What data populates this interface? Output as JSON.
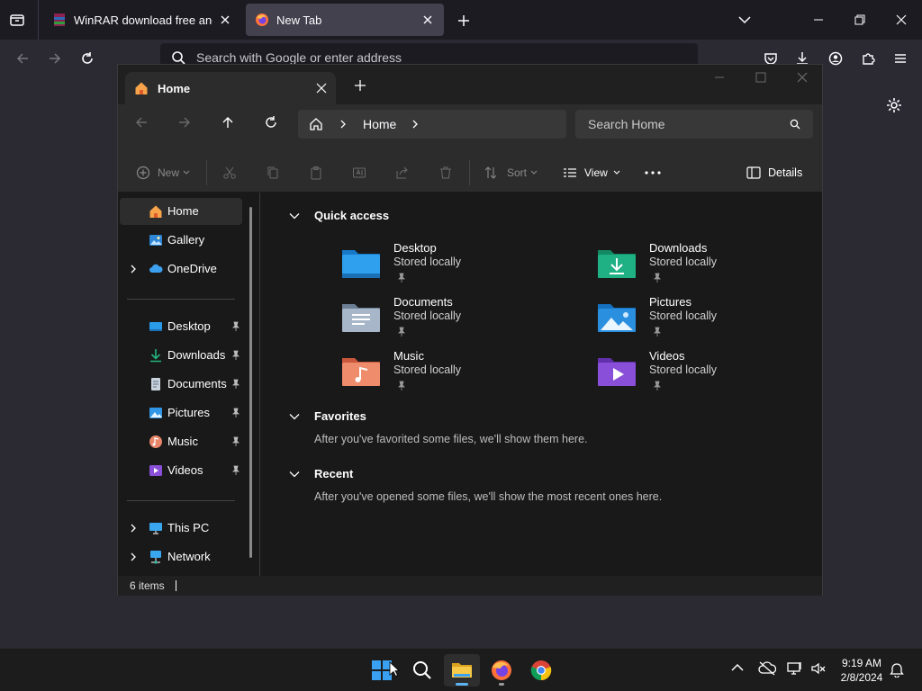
{
  "browser": {
    "tabs": [
      {
        "title": "WinRAR download free and support"
      },
      {
        "title": "New Tab"
      }
    ],
    "urlbar_placeholder": "Search with Google or enter address"
  },
  "explorer": {
    "tab_title": "Home",
    "breadcrumb": [
      "Home"
    ],
    "search_placeholder": "Search Home",
    "toolbar": {
      "new_label": "New",
      "sort_label": "Sort",
      "view_label": "View",
      "details_label": "Details"
    },
    "sidebar": {
      "top": [
        {
          "label": "Home",
          "icon": "home-icon",
          "selected": true
        },
        {
          "label": "Gallery",
          "icon": "gallery-icon"
        },
        {
          "label": "OneDrive",
          "icon": "onedrive-icon",
          "expandable": true
        }
      ],
      "pinned": [
        {
          "label": "Desktop",
          "icon": "desktop-folder-icon"
        },
        {
          "label": "Downloads",
          "icon": "downloads-icon"
        },
        {
          "label": "Documents",
          "icon": "documents-icon"
        },
        {
          "label": "Pictures",
          "icon": "pictures-icon"
        },
        {
          "label": "Music",
          "icon": "music-icon"
        },
        {
          "label": "Videos",
          "icon": "videos-icon"
        }
      ],
      "bottom": [
        {
          "label": "This PC",
          "icon": "this-pc-icon",
          "expandable": true
        },
        {
          "label": "Network",
          "icon": "network-icon",
          "expandable": true
        }
      ]
    },
    "sections": {
      "quick_access": {
        "title": "Quick access",
        "items": [
          {
            "name": "Desktop",
            "sub": "Stored locally",
            "color": "#1e90e6"
          },
          {
            "name": "Downloads",
            "sub": "Stored locally",
            "color": "#1aa37a"
          },
          {
            "name": "Documents",
            "sub": "Stored locally",
            "color": "#8ea3bd"
          },
          {
            "name": "Pictures",
            "sub": "Stored locally",
            "color": "#2b8fe0"
          },
          {
            "name": "Music",
            "sub": "Stored locally",
            "color": "#e8866a"
          },
          {
            "name": "Videos",
            "sub": "Stored locally",
            "color": "#8a4fd8"
          }
        ]
      },
      "favorites": {
        "title": "Favorites",
        "note": "After you've favorited some files, we'll show them here."
      },
      "recent": {
        "title": "Recent",
        "note": "After you've opened some files, we'll show the most recent ones here."
      }
    },
    "status": "6 items"
  },
  "taskbar": {
    "time": "9:19 AM",
    "date": "2/8/2024",
    "apps": [
      "start-icon",
      "search-icon",
      "file-explorer-icon",
      "firefox-icon",
      "chrome-icon"
    ]
  }
}
